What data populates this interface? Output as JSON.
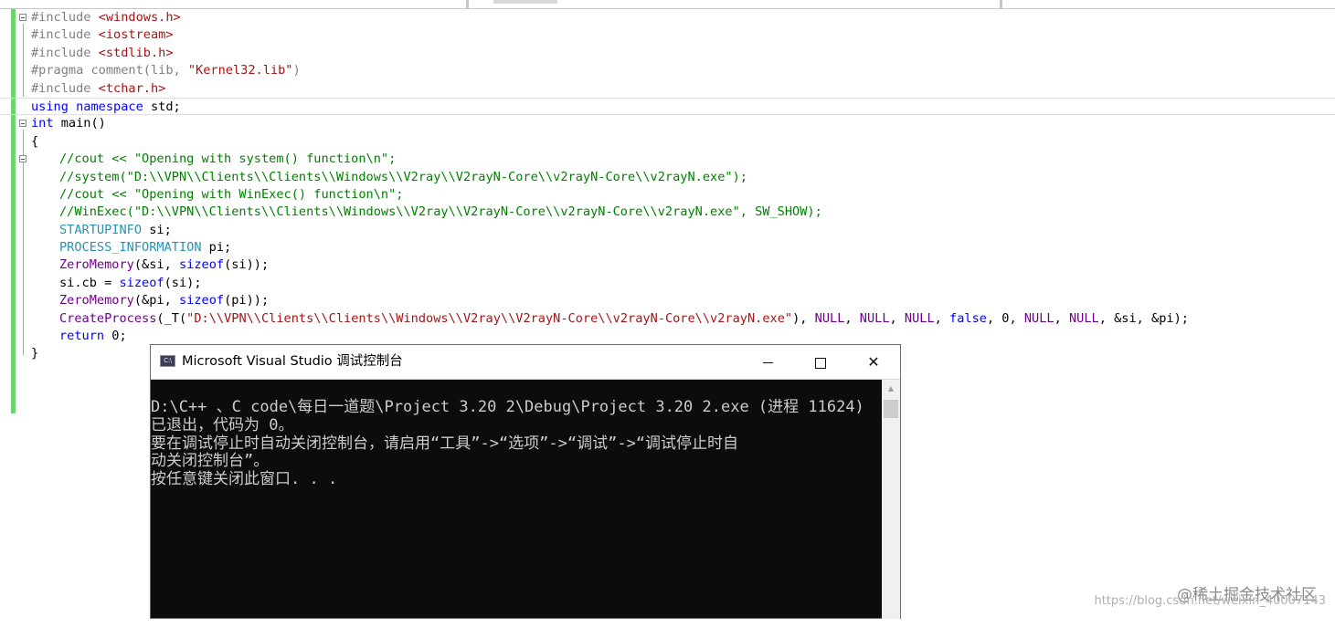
{
  "editor": {
    "lines": [
      [
        {
          "t": "#include ",
          "c": "pp"
        },
        {
          "t": "<windows.h>",
          "c": "inc"
        }
      ],
      [
        {
          "t": "#include ",
          "c": "pp"
        },
        {
          "t": "<iostream>",
          "c": "inc"
        }
      ],
      [
        {
          "t": "#include ",
          "c": "pp"
        },
        {
          "t": "<stdlib.h>",
          "c": "inc"
        }
      ],
      [
        {
          "t": "#pragma comment",
          "c": "pp"
        },
        {
          "t": "(lib, ",
          "c": "pp"
        },
        {
          "t": "\"Kernel32.lib\"",
          "c": "str"
        },
        {
          "t": ")",
          "c": "pp"
        }
      ],
      [
        {
          "t": "#include ",
          "c": "pp"
        },
        {
          "t": "<tchar.h>",
          "c": "inc"
        }
      ],
      [
        {
          "t": "using",
          "c": "kw"
        },
        {
          "t": " "
        },
        {
          "t": "namespace",
          "c": "kw"
        },
        {
          "t": " std;"
        }
      ],
      [
        {
          "t": "int",
          "c": "kw"
        },
        {
          "t": " main()"
        }
      ],
      [
        {
          "t": "{"
        }
      ],
      [
        {
          "t": "//cout << \"Opening with system() function\\n\";",
          "c": "cm"
        }
      ],
      [
        {
          "t": "//system(\"D:\\\\VPN\\\\Clients\\\\Clients\\\\Windows\\\\V2ray\\\\V2rayN-Core\\\\v2rayN-Core\\\\v2rayN.exe\");",
          "c": "cm"
        }
      ],
      [
        {
          "t": "//cout << \"Opening with WinExec() function\\n\";",
          "c": "cm"
        }
      ],
      [
        {
          "t": "//WinExec(\"D:\\\\VPN\\\\Clients\\\\Clients\\\\Windows\\\\V2ray\\\\V2rayN-Core\\\\v2rayN-Core\\\\v2rayN.exe\", SW_SHOW);",
          "c": "cm"
        }
      ],
      [
        {
          "t": "STARTUPINFO",
          "c": "ty"
        },
        {
          "t": " si;"
        }
      ],
      [
        {
          "t": "PROCESS_INFORMATION",
          "c": "ty"
        },
        {
          "t": " pi;"
        }
      ],
      [
        {
          "t": "ZeroMemory",
          "c": "mac"
        },
        {
          "t": "(&si, "
        },
        {
          "t": "sizeof",
          "c": "kw"
        },
        {
          "t": "(si));"
        }
      ],
      [
        {
          "t": "si.cb = "
        },
        {
          "t": "sizeof",
          "c": "kw"
        },
        {
          "t": "(si);"
        }
      ],
      [
        {
          "t": "ZeroMemory",
          "c": "mac"
        },
        {
          "t": "(&pi, "
        },
        {
          "t": "sizeof",
          "c": "kw"
        },
        {
          "t": "(pi));"
        }
      ],
      [
        {
          "t": "CreateProcess",
          "c": "mac"
        },
        {
          "t": "(_T("
        },
        {
          "t": "\"D:\\\\VPN\\\\Clients\\\\Clients\\\\Windows\\\\V2ray\\\\V2rayN-Core\\\\v2rayN-Core\\\\v2rayN.exe\"",
          "c": "str"
        },
        {
          "t": "), "
        },
        {
          "t": "NULL",
          "c": "mac"
        },
        {
          "t": ", "
        },
        {
          "t": "NULL",
          "c": "mac"
        },
        {
          "t": ", "
        },
        {
          "t": "NULL",
          "c": "mac"
        },
        {
          "t": ", "
        },
        {
          "t": "false",
          "c": "kw"
        },
        {
          "t": ", 0, "
        },
        {
          "t": "NULL",
          "c": "mac"
        },
        {
          "t": ", "
        },
        {
          "t": "NULL",
          "c": "mac"
        },
        {
          "t": ", &si, &pi);"
        }
      ],
      [
        {
          "t": "return",
          "c": "kw"
        },
        {
          "t": " 0;"
        }
      ],
      [
        {
          "t": "}"
        }
      ]
    ]
  },
  "console": {
    "icon_label": "C:\\",
    "title": "Microsoft Visual Studio 调试控制台",
    "minimize_icon": "minimize-icon",
    "maximize_icon": "maximize-icon",
    "close_glyph": "✕",
    "scroll_up_glyph": "▲",
    "output": "D:\\C++ 、C code\\每日一道题\\Project 3.20 2\\Debug\\Project 3.20 2.exe (进程 11624)\n已退出，代码为 0。\n要在调试停止时自动关闭控制台，请启用“工具”->“选项”->“调试”->“调试停止时自\n动关闭控制台”。\n按任意键关闭此窗口. . ."
  },
  "watermark": {
    "text": "@稀土掘金技术社区",
    "url": "https://blog.csdn.net/weixin_40007143"
  }
}
